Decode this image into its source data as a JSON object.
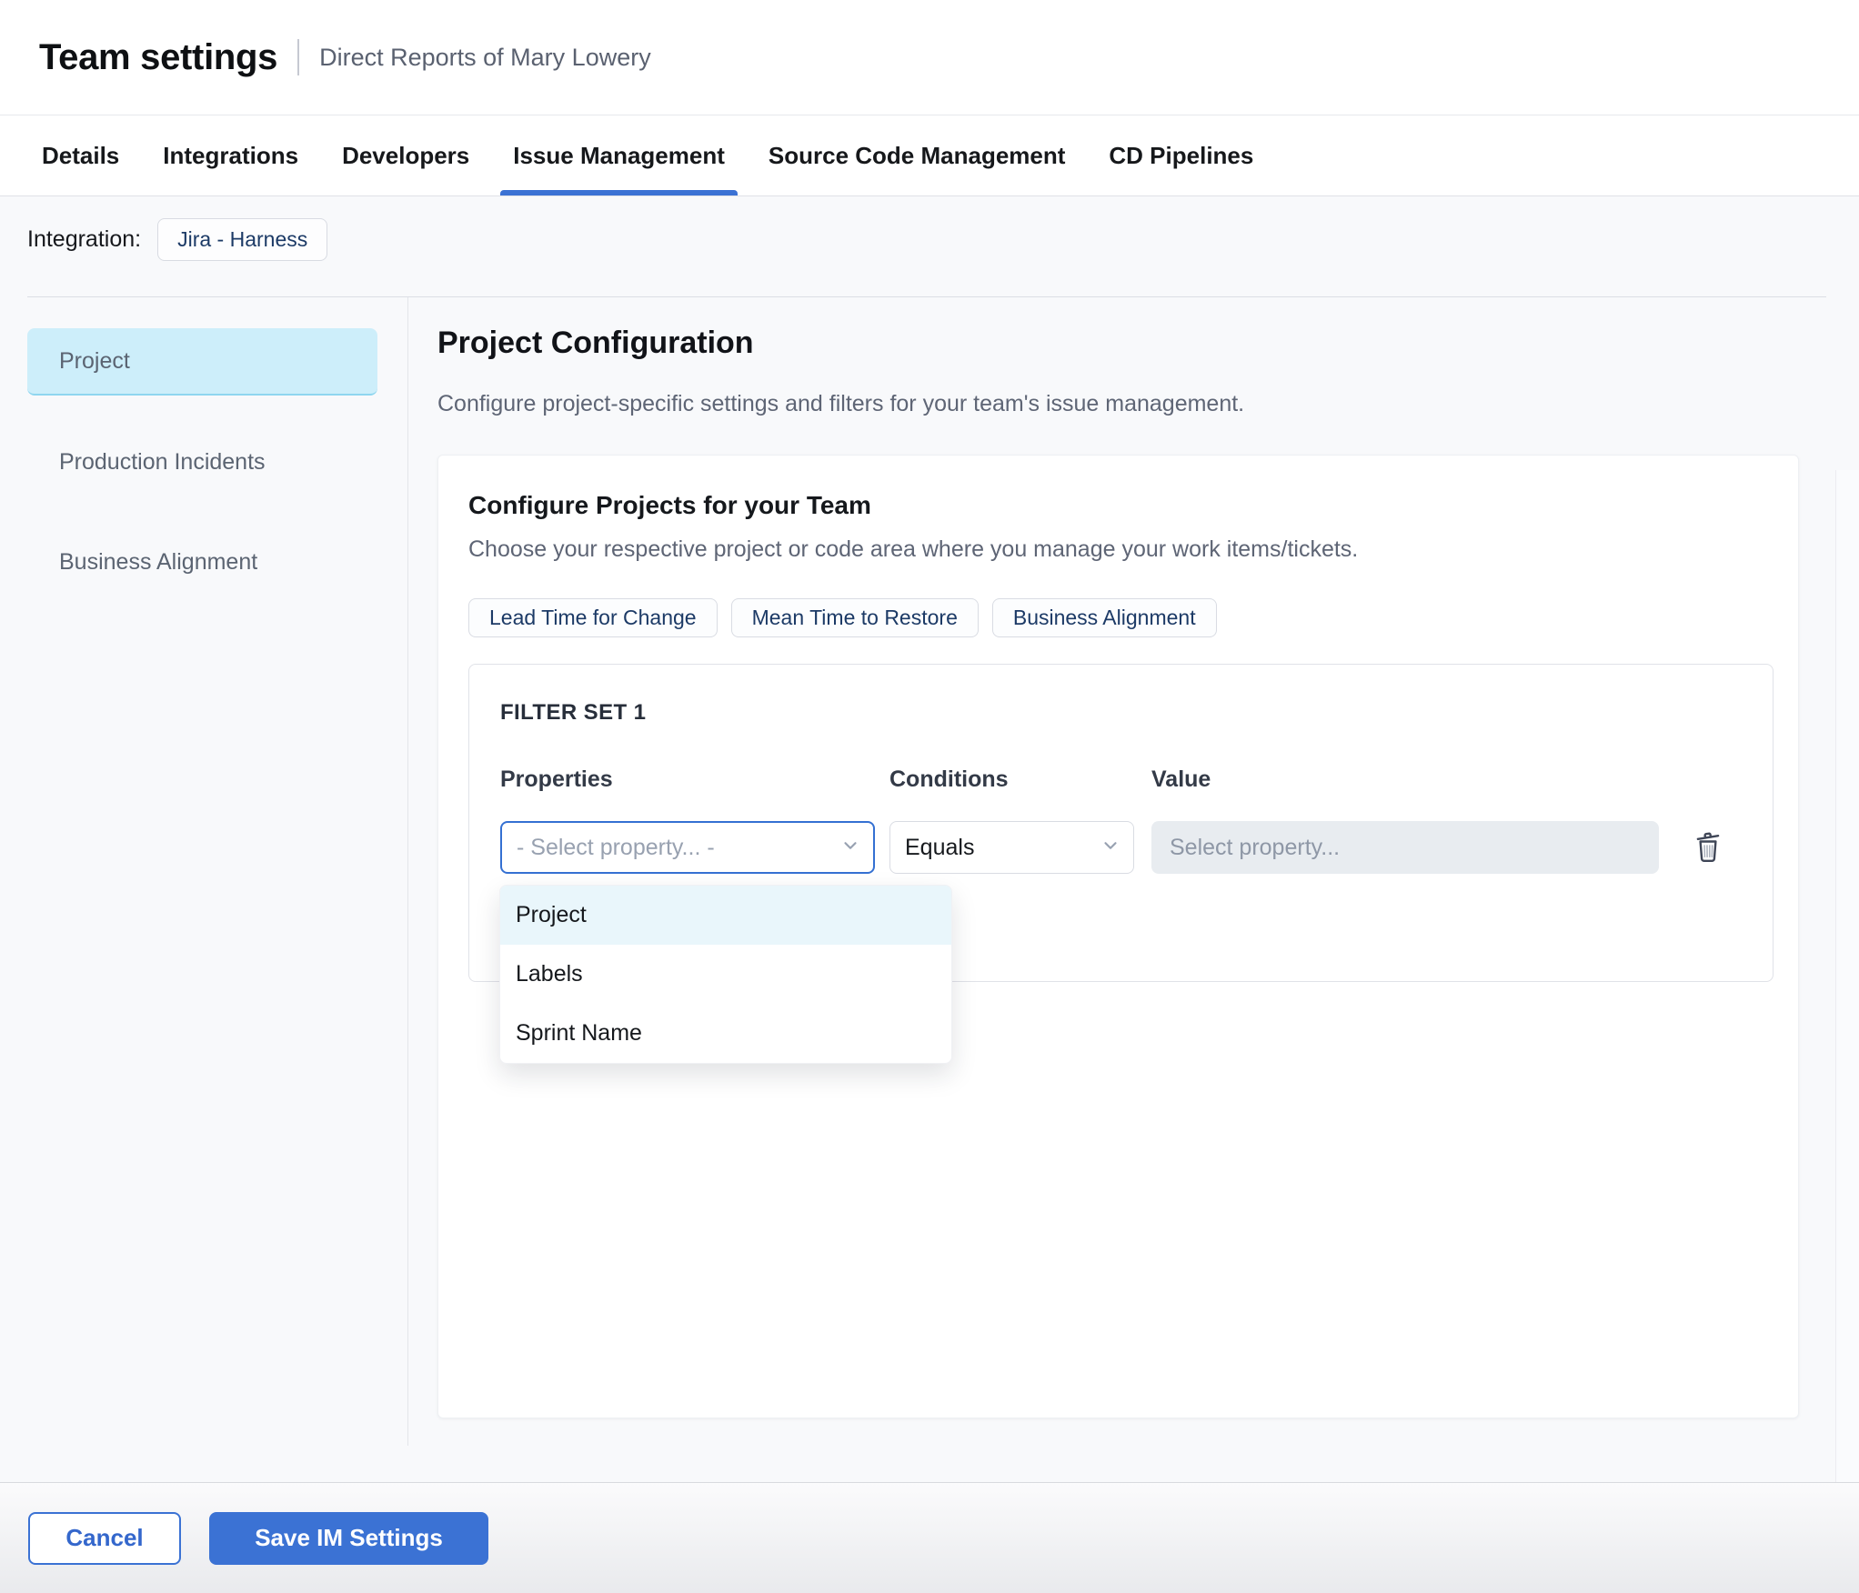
{
  "page": {
    "title": "Team settings",
    "subtitle": "Direct Reports of Mary Lowery"
  },
  "tabs": {
    "items": [
      {
        "label": "Details"
      },
      {
        "label": "Integrations"
      },
      {
        "label": "Developers"
      },
      {
        "label": "Issue Management"
      },
      {
        "label": "Source Code Management"
      },
      {
        "label": "CD Pipelines"
      }
    ],
    "active": "Issue Management"
  },
  "integration": {
    "label": "Integration:",
    "value": "Jira - Harness"
  },
  "sidebar": {
    "items": [
      {
        "label": "Project",
        "selected": true
      },
      {
        "label": "Production Incidents",
        "selected": false
      },
      {
        "label": "Business Alignment",
        "selected": false
      }
    ]
  },
  "content": {
    "heading": "Project Configuration",
    "description": "Configure project-specific settings and filters for your team's issue management.",
    "card": {
      "heading": "Configure Projects for your Team",
      "description": "Choose your respective project or code area where you manage your work items/tickets.",
      "metric_buttons": [
        {
          "label": "Lead Time for Change"
        },
        {
          "label": "Mean Time to Restore"
        },
        {
          "label": "Business Alignment"
        }
      ],
      "filter_set": {
        "title": "FILTER SET 1",
        "properties_label": "Properties",
        "conditions_label": "Conditions",
        "value_label": "Value",
        "property_placeholder": "- Select property... -",
        "condition_value": "Equals",
        "value_placeholder": "Select property...",
        "property_options": [
          {
            "label": "Project",
            "highlighted": true
          },
          {
            "label": "Labels",
            "highlighted": false
          },
          {
            "label": "Sprint Name",
            "highlighted": false
          }
        ]
      }
    }
  },
  "footer": {
    "cancel": "Cancel",
    "save": "Save IM Settings"
  },
  "colors": {
    "accent": "#3b72d4",
    "sidebar_selected_bg": "#cdeefa",
    "dropdown_highlight": "#e9f6fb",
    "value_input_bg": "#e8ecf0",
    "content_bg": "#f8f9fb",
    "chip_text": "#1c3a66"
  }
}
